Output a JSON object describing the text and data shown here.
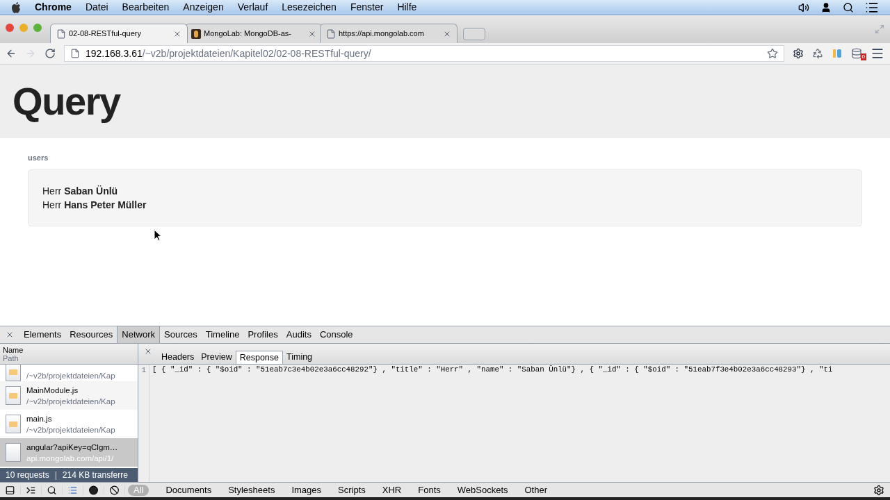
{
  "menubar": {
    "app": "Chrome",
    "items": [
      "Datei",
      "Bearbeiten",
      "Anzeigen",
      "Verlauf",
      "Lesezeichen",
      "Fenster",
      "Hilfe"
    ]
  },
  "tabs": [
    {
      "title": "02-08-RESTful-query",
      "selected": true,
      "kind": "page"
    },
    {
      "title": "MongoLab: MongoDB-as-",
      "selected": false,
      "kind": "logo"
    },
    {
      "title": "https://api.mongolab.com",
      "selected": false,
      "kind": "page"
    }
  ],
  "address": {
    "host": "192.168.3.61",
    "path": "/~v2b/projektdateien/Kapitel02/02-08-RESTful-query/"
  },
  "extension_badge": "0",
  "page": {
    "heading": "Query",
    "section_label": "users",
    "users": [
      {
        "title": "Herr",
        "name": "Saban Ünlü"
      },
      {
        "title": "Herr",
        "name": "Hans Peter Müller"
      }
    ]
  },
  "devtools": {
    "panels": [
      {
        "label": "Elements",
        "selected": false
      },
      {
        "label": "Resources",
        "selected": false
      },
      {
        "label": "Network",
        "selected": true
      },
      {
        "label": "Sources",
        "selected": false
      },
      {
        "label": "Timeline",
        "selected": false
      },
      {
        "label": "Profiles",
        "selected": false
      },
      {
        "label": "Audits",
        "selected": false
      },
      {
        "label": "Console",
        "selected": false
      }
    ],
    "list_header": {
      "name": "Name",
      "path": "Path"
    },
    "requests": [
      {
        "path": "/~v2b/projektdateien/Kap",
        "selected": false,
        "kind": "js"
      },
      {
        "name": "MainModule.js",
        "path": "/~v2b/projektdateien/Kap",
        "selected": false,
        "kind": "js"
      },
      {
        "name": "main.js",
        "path": "/~v2b/projektdateien/Kap",
        "selected": false,
        "kind": "js"
      },
      {
        "name": "angular?apiKey=qClgm…",
        "path": "api.mongolab.com/api/1/",
        "selected": true,
        "kind": "blank"
      }
    ],
    "summary": {
      "requests": "10 requests",
      "separator": "|",
      "transferred": "214 KB transferre"
    },
    "detail_tabs": [
      {
        "label": "Headers",
        "selected": false
      },
      {
        "label": "Preview",
        "selected": false
      },
      {
        "label": "Response",
        "selected": true
      },
      {
        "label": "Timing",
        "selected": false
      }
    ],
    "response": {
      "line_number": "1",
      "text": "[ { \"_id\" : { \"$oid\" : \"51eab7c3e4b02e3a6cc48292\"} , \"title\" : \"Herr\" , \"name\" : \"Saban Ünlü\"} , { \"_id\" : { \"$oid\" : \"51eab7f3e4b02e3a6cc48293\"} , \"ti"
    },
    "filters": [
      {
        "label": "All",
        "selected": true
      },
      {
        "label": "Documents",
        "selected": false
      },
      {
        "label": "Stylesheets",
        "selected": false
      },
      {
        "label": "Images",
        "selected": false
      },
      {
        "label": "Scripts",
        "selected": false
      },
      {
        "label": "XHR",
        "selected": false
      },
      {
        "label": "Fonts",
        "selected": false
      },
      {
        "label": "WebSockets",
        "selected": false
      },
      {
        "label": "Other",
        "selected": false
      }
    ]
  }
}
